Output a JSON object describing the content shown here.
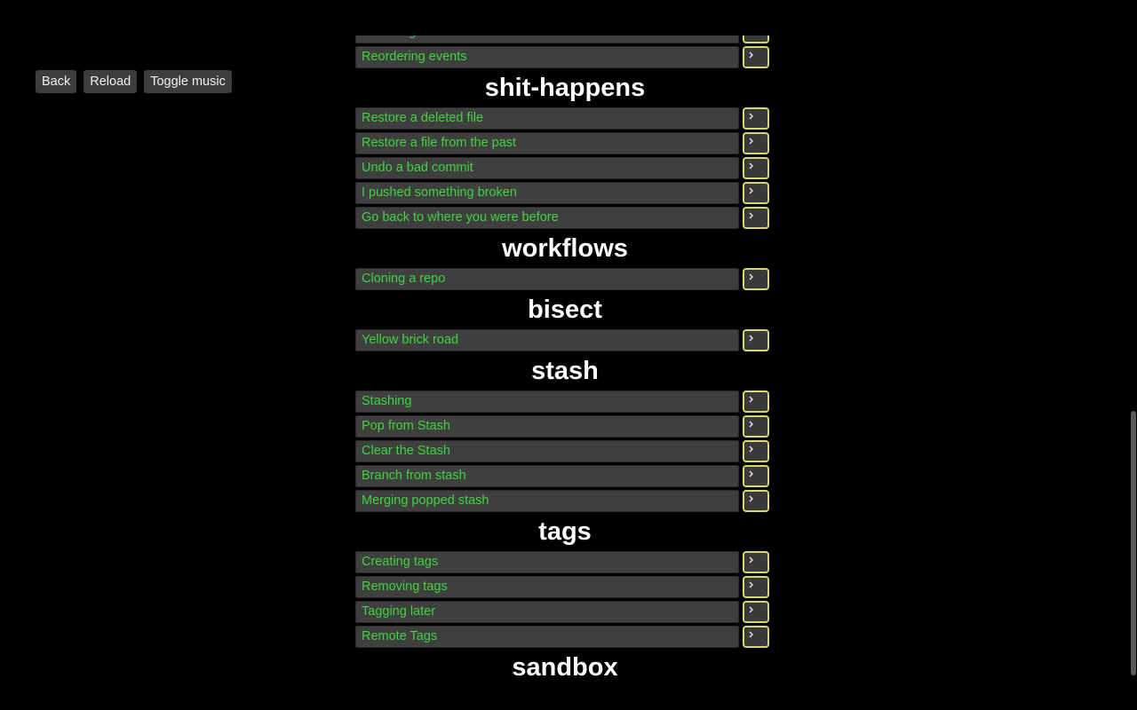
{
  "toolbar": {
    "back_label": "Back",
    "reload_label": "Reload",
    "music_label": "Toggle music"
  },
  "colors": {
    "background": "#000000",
    "level_text": "#3fd33f",
    "level_bg": "#3f3f3f",
    "cmd_border": "#d8d86a",
    "title": "#ffffff"
  },
  "sections": [
    {
      "title": "",
      "levels": [
        "Rebasing",
        "Reordering events"
      ]
    },
    {
      "title": "shit-happens",
      "levels": [
        "Restore a deleted file",
        "Restore a file from the past",
        "Undo a bad commit",
        "I pushed something broken",
        "Go back to where you were before"
      ]
    },
    {
      "title": "workflows",
      "levels": [
        "Cloning a repo"
      ]
    },
    {
      "title": "bisect",
      "levels": [
        "Yellow brick road"
      ]
    },
    {
      "title": "stash",
      "levels": [
        "Stashing",
        "Pop from Stash",
        "Clear the Stash",
        "Branch from stash",
        "Merging popped stash"
      ]
    },
    {
      "title": "tags",
      "levels": [
        "Creating tags",
        "Removing tags",
        "Tagging later",
        "Remote Tags"
      ]
    },
    {
      "title": "sandbox",
      "levels": []
    }
  ],
  "icons": {
    "command": "terminal-prompt-icon"
  }
}
